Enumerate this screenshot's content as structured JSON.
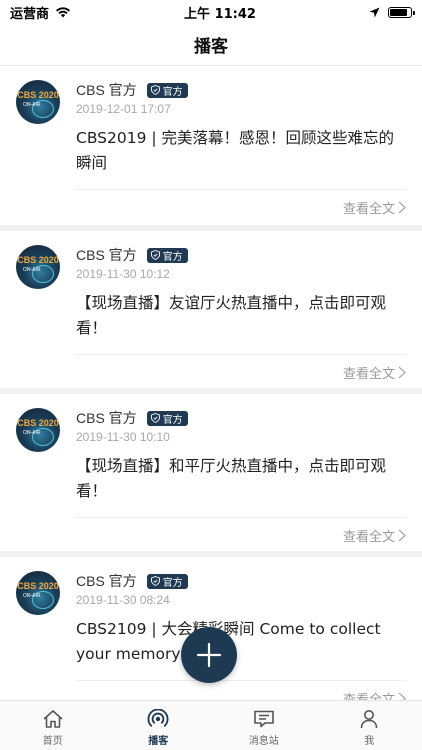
{
  "status_bar": {
    "carrier": "运营商",
    "time": "上午 11:42"
  },
  "nav": {
    "title": "播客"
  },
  "posts": [
    {
      "avatar_text": "CBS 2020",
      "avatar_sub": "ON-AIR",
      "author": "CBS 官方",
      "badge": "官方",
      "time": "2019-12-01 17:07",
      "text": "CBS2019 | 完美落幕！感恩！回顾这些难忘的瞬间",
      "read_more": "查看全文"
    },
    {
      "avatar_text": "CBS 2020",
      "avatar_sub": "ON-AIR",
      "author": "CBS 官方",
      "badge": "官方",
      "time": "2019-11-30 10:12",
      "text": "【现场直播】友谊厅火热直播中，点击即可观看！",
      "read_more": "查看全文"
    },
    {
      "avatar_text": "CBS 2020",
      "avatar_sub": "ON-AIR",
      "author": "CBS 官方",
      "badge": "官方",
      "time": "2019-11-30 10:10",
      "text": "【现场直播】和平厅火热直播中，点击即可观看！",
      "read_more": "查看全文"
    },
    {
      "avatar_text": "CBS 2020",
      "avatar_sub": "ON-AIR",
      "author": "CBS 官方",
      "badge": "官方",
      "time": "2019-11-30 08:24",
      "text": "CBS2109 | 大会精彩瞬间 Come to collect your memory",
      "read_more": "查看全文"
    }
  ],
  "tabs": [
    {
      "label": "首页",
      "icon": "home-icon",
      "active": false
    },
    {
      "label": "播客",
      "icon": "broadcast-icon",
      "active": true
    },
    {
      "label": "消息站",
      "icon": "message-icon",
      "active": false
    },
    {
      "label": "我",
      "icon": "user-icon",
      "active": false
    }
  ],
  "colors": {
    "accent": "#1e3a53",
    "badge": "#1f3a52",
    "time_text": "#a8a8a8",
    "read_more": "#9a9a9a"
  }
}
